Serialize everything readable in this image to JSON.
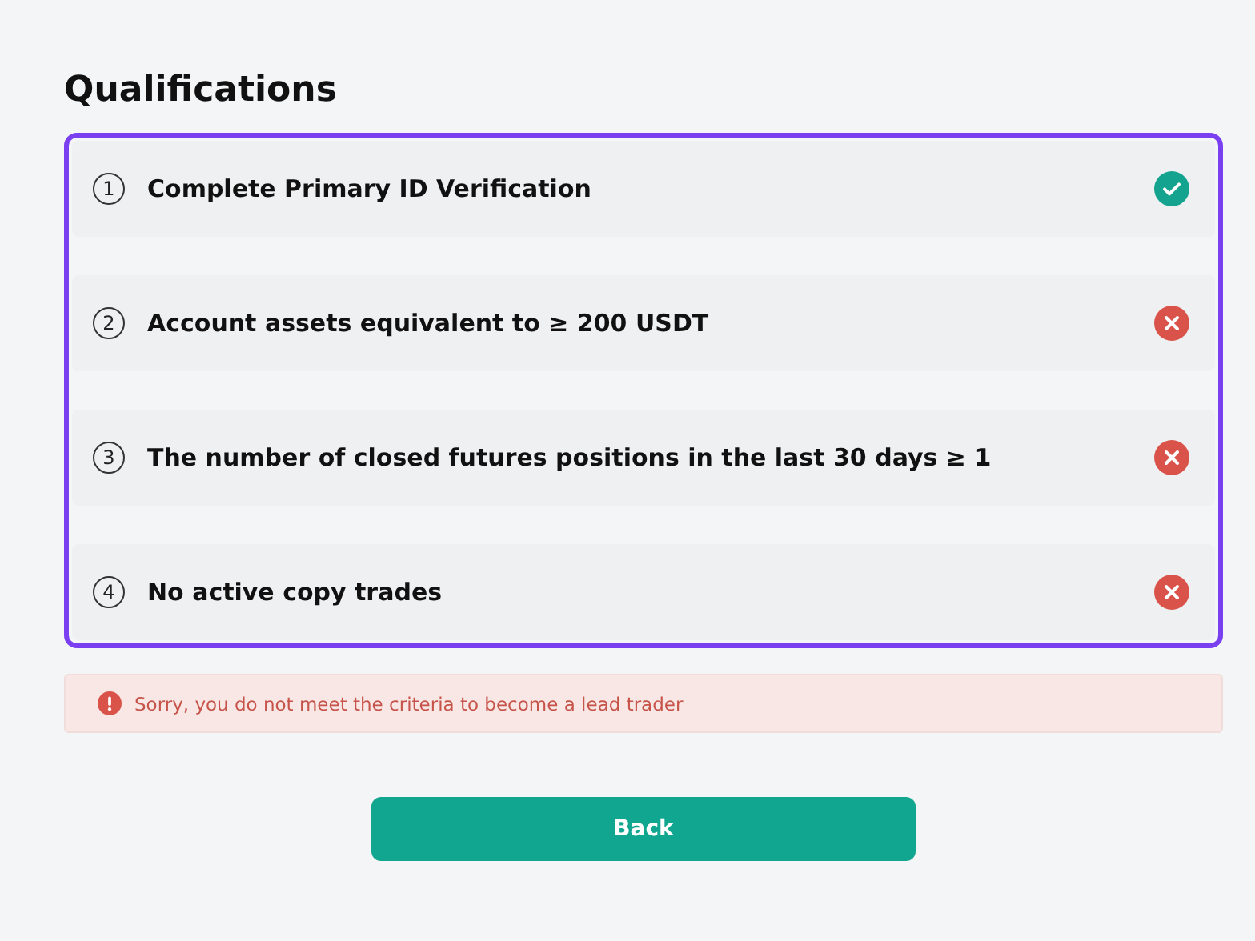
{
  "title": "Qualifications",
  "criteria": [
    {
      "number": "1",
      "label": "Complete Primary ID Verification",
      "met": true
    },
    {
      "number": "2",
      "label": "Account assets equivalent to ≥ 200 USDT",
      "met": false
    },
    {
      "number": "3",
      "label": "The number of closed futures positions in the last 30 days ≥ 1",
      "met": false
    },
    {
      "number": "4",
      "label": "No active copy trades",
      "met": false
    }
  ],
  "alert": {
    "text": "Sorry, you do not meet the criteria to become a lead trader"
  },
  "back_button": "Back"
}
